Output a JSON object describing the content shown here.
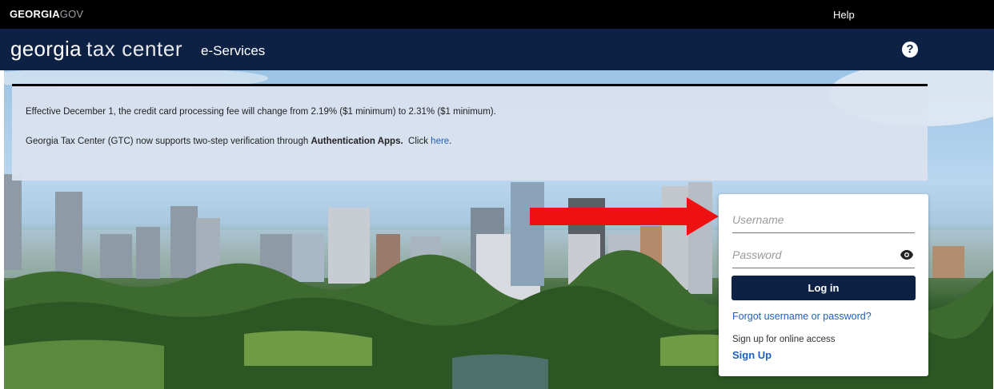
{
  "topbar": {
    "brand_bold": "GEORGIA",
    "brand_light": "GOV",
    "help_label": "Help"
  },
  "header": {
    "logo_main": "georgia",
    "logo_sub": "tax center",
    "subtitle": "e-Services",
    "help_icon_glyph": "?"
  },
  "notice": {
    "line1": "Effective December 1, the credit card processing fee will change from 2.19% ($1 minimum) to 2.31% ($1 minimum).",
    "line2_prefix": "Georgia Tax Center (GTC) now supports two-step verification through ",
    "line2_bold": "Authentication Apps.",
    "line2_mid": "  Click ",
    "line2_link": "here",
    "line2_suffix": "."
  },
  "login": {
    "username_placeholder": "Username",
    "password_placeholder": "Password",
    "login_button": "Log in",
    "forgot_link": "Forgot username or password?",
    "signup_prompt": "Sign up for online access",
    "signup_link": "Sign Up"
  },
  "icons": {
    "help": "question-circle-icon",
    "password_toggle": "eye-icon",
    "pointer": "red-arrow-icon"
  },
  "colors": {
    "header_bg": "#0d2144",
    "topbar_bg": "#000000",
    "link": "#1f5fbf",
    "button_bg": "#0d2144",
    "arrow": "#ee1111"
  }
}
